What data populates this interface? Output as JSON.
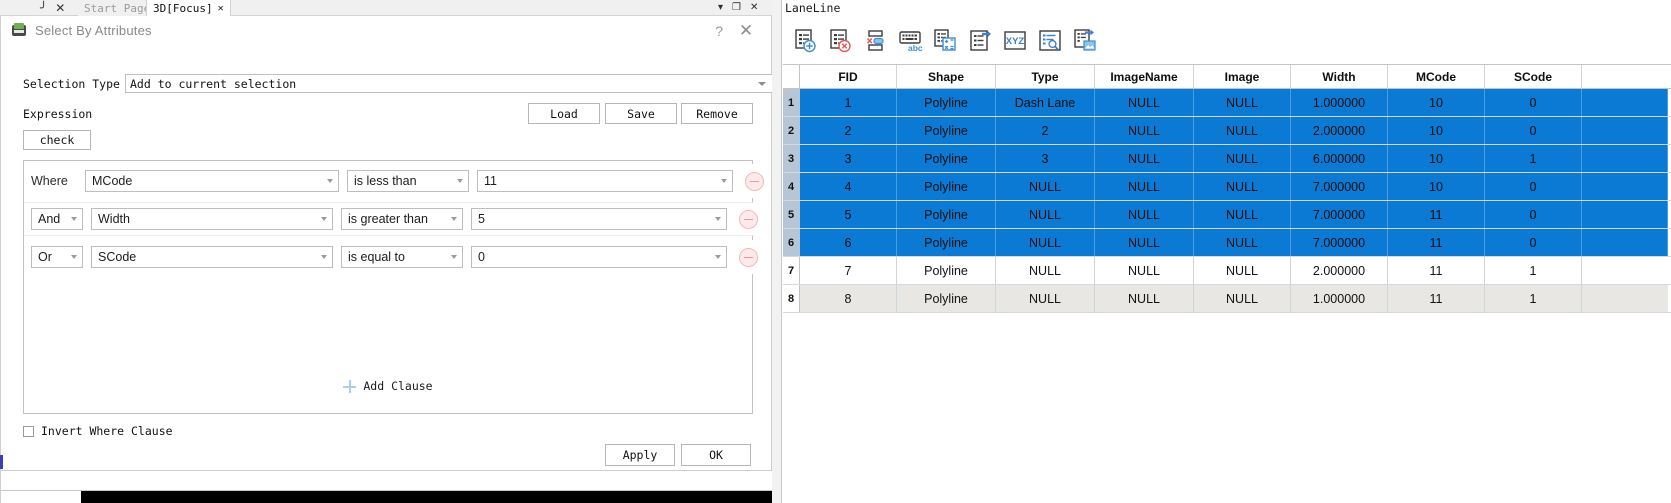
{
  "tabstrip": {
    "pin_icon": "pin-icon",
    "close_icon": "✕",
    "tabs": [
      {
        "label": "Start Page",
        "close": "✕",
        "active": false
      },
      {
        "label": "3D[Focus]",
        "close": "✕",
        "active": true
      }
    ]
  },
  "window_controls": {
    "dropdown": "▾",
    "restore": "❐",
    "close": "✕"
  },
  "dialog": {
    "title": "Select By Attributes",
    "help_glyph": "?",
    "close_glyph": "✕",
    "selection_type": {
      "label": "Selection Type",
      "value": "Add to current selection"
    },
    "expression": {
      "label": "Expression",
      "load_label": "Load",
      "save_label": "Save",
      "remove_label": "Remove",
      "check_label": "check"
    },
    "clauses": [
      {
        "connector": "Where",
        "field": "MCode",
        "operator": "is less than",
        "value": "11"
      },
      {
        "connector": "And",
        "field": "Width",
        "operator": "is greater than",
        "value": "5"
      },
      {
        "connector": "Or",
        "field": "SCode",
        "operator": "is equal to",
        "value": "0"
      }
    ],
    "add_clause_label": "Add Clause",
    "invert_label": "Invert Where Clause",
    "invert_checked": false,
    "apply_label": "Apply",
    "ok_label": "OK"
  },
  "table_panel": {
    "title": "LaneLine",
    "toolbar": [
      {
        "name": "add-record-icon",
        "tooltip": "Add Record"
      },
      {
        "name": "delete-record-icon",
        "tooltip": "Delete Record"
      },
      {
        "name": "delete-field-icon",
        "tooltip": "Delete Field"
      },
      {
        "name": "keyboard-abc-icon",
        "tooltip": "Rename Field"
      },
      {
        "name": "calculate-field-icon",
        "tooltip": "Field Calculator"
      },
      {
        "name": "export-list-icon",
        "tooltip": "Export"
      },
      {
        "name": "xyz-icon",
        "tooltip": "XYZ"
      },
      {
        "name": "select-by-attributes-icon",
        "tooltip": "Select By Attributes"
      },
      {
        "name": "attach-image-icon",
        "tooltip": "Attach Image"
      }
    ],
    "columns": [
      "",
      "FID",
      "Shape",
      "Type",
      "ImageName",
      "Image",
      "Width",
      "MCode",
      "SCode",
      ""
    ],
    "rows": [
      {
        "num": "1",
        "selected": true,
        "alt": false,
        "cells": [
          "1",
          "Polyline",
          "Dash Lane",
          "NULL",
          "NULL",
          "1.000000",
          "10",
          "0"
        ]
      },
      {
        "num": "2",
        "selected": true,
        "alt": false,
        "cells": [
          "2",
          "Polyline",
          "2",
          "NULL",
          "NULL",
          "2.000000",
          "10",
          "0"
        ]
      },
      {
        "num": "3",
        "selected": true,
        "alt": false,
        "cells": [
          "3",
          "Polyline",
          "3",
          "NULL",
          "NULL",
          "6.000000",
          "10",
          "1"
        ]
      },
      {
        "num": "4",
        "selected": true,
        "alt": false,
        "cells": [
          "4",
          "Polyline",
          "NULL",
          "NULL",
          "NULL",
          "7.000000",
          "10",
          "0"
        ]
      },
      {
        "num": "5",
        "selected": true,
        "alt": false,
        "cells": [
          "5",
          "Polyline",
          "NULL",
          "NULL",
          "NULL",
          "7.000000",
          "11",
          "0"
        ]
      },
      {
        "num": "6",
        "selected": true,
        "alt": false,
        "cells": [
          "6",
          "Polyline",
          "NULL",
          "NULL",
          "NULL",
          "7.000000",
          "11",
          "0"
        ]
      },
      {
        "num": "7",
        "selected": false,
        "alt": false,
        "cells": [
          "7",
          "Polyline",
          "NULL",
          "NULL",
          "NULL",
          "2.000000",
          "11",
          "1"
        ]
      },
      {
        "num": "8",
        "selected": false,
        "alt": true,
        "cells": [
          "8",
          "Polyline",
          "NULL",
          "NULL",
          "NULL",
          "1.000000",
          "11",
          "1"
        ]
      }
    ]
  },
  "colors": {
    "selection_blue": "#0b7ad4",
    "row_header_selected": "#b7c6d6",
    "alt_row": "#e9e7e3",
    "accent_light_blue": "#a9cdf0",
    "remove_pink": "#fdeaea"
  }
}
